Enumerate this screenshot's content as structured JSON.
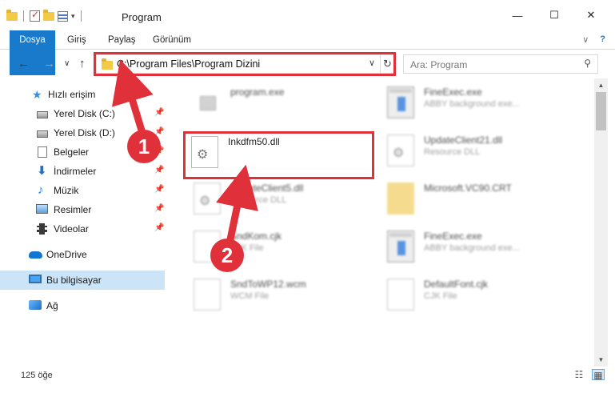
{
  "window": {
    "title": "Program"
  },
  "window_controls": {
    "minimize": "—",
    "maximize": "☐",
    "close": "✕"
  },
  "ribbon": {
    "tabs": [
      "Dosya",
      "Giriş",
      "Paylaş",
      "Görünüm"
    ],
    "expand_glyph": "∨",
    "help_glyph": "?"
  },
  "nav": {
    "back": "←",
    "forward": "→",
    "recent": "∨",
    "up": "↑",
    "address": "C:\\Program Files\\Program Dizini",
    "dropdown_glyph": "∨",
    "refresh_glyph": "↻",
    "search_placeholder": "Ara: Program",
    "search_glyph": "⚲"
  },
  "sidebar": {
    "items": [
      {
        "label": "Hızlı erişim",
        "icon": "star-icon",
        "pinned": false
      },
      {
        "label": "Yerel Disk (C:)",
        "icon": "drive-icon",
        "pinned": true
      },
      {
        "label": "Yerel Disk (D:)",
        "icon": "drive-icon",
        "pinned": true
      },
      {
        "label": "Belgeler",
        "icon": "documents-icon",
        "pinned": true
      },
      {
        "label": "İndirmeler",
        "icon": "downloads-icon",
        "pinned": true
      },
      {
        "label": "Müzik",
        "icon": "music-icon",
        "pinned": true
      },
      {
        "label": "Resimler",
        "icon": "pictures-icon",
        "pinned": true
      },
      {
        "label": "Videolar",
        "icon": "videos-icon",
        "pinned": true
      },
      {
        "label": "OneDrive",
        "icon": "onedrive-icon",
        "pinned": false
      },
      {
        "label": "Bu bilgisayar",
        "icon": "computer-icon",
        "pinned": false,
        "selected": true
      },
      {
        "label": "Ağ",
        "icon": "network-icon",
        "pinned": false
      }
    ],
    "pin_glyph": "📌"
  },
  "files": [
    {
      "name": "program.exe",
      "desc": "",
      "icon": "exe-icon"
    },
    {
      "name": "FineExec.exe",
      "desc": "ABBY background exe...",
      "icon": "window-icon"
    },
    {
      "name": "Inkdfm50.dll",
      "desc": "",
      "icon": "dll-gear-icon",
      "highlighted": true
    },
    {
      "name": "UpdateClient21.dll",
      "desc": "Resource DLL",
      "icon": "dll-gear-icon"
    },
    {
      "name": "UpdateClient5.dll",
      "desc": "Resource DLL",
      "icon": "dll-gear-icon"
    },
    {
      "name": "Microsoft.VC90.CRT",
      "desc": "",
      "icon": "folder-icon"
    },
    {
      "name": "SndKom.cjk",
      "desc": "CJK File",
      "icon": "page-icon"
    },
    {
      "name": "FineExec.exe",
      "desc": "ABBY background exe...",
      "icon": "window-icon"
    },
    {
      "name": "SndToWP12.wcm",
      "desc": "WCM File",
      "icon": "page-icon"
    },
    {
      "name": "DefaultFont.cjk",
      "desc": "CJK File",
      "icon": "page-icon"
    }
  ],
  "annotations": {
    "step1": "1",
    "step2": "2",
    "color": "#e0303a"
  },
  "status": {
    "count": "125 öğe"
  },
  "views": {
    "details": "☷",
    "tiles": "▦"
  }
}
